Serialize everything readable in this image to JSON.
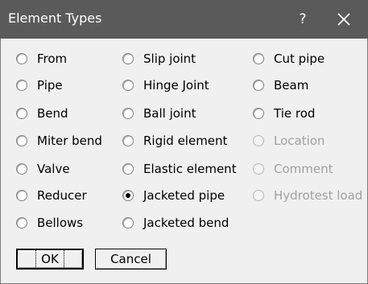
{
  "dialog": {
    "title": "Element Types",
    "help_label": "?",
    "close_icon": "close-icon"
  },
  "options": [
    {
      "label": "From",
      "checked": false,
      "enabled": true
    },
    {
      "label": "Pipe",
      "checked": false,
      "enabled": true
    },
    {
      "label": "Bend",
      "checked": false,
      "enabled": true
    },
    {
      "label": "Miter bend",
      "checked": false,
      "enabled": true
    },
    {
      "label": "Valve",
      "checked": false,
      "enabled": true
    },
    {
      "label": "Reducer",
      "checked": false,
      "enabled": true
    },
    {
      "label": "Bellows",
      "checked": false,
      "enabled": true
    },
    {
      "label": "Slip joint",
      "checked": false,
      "enabled": true
    },
    {
      "label": "Hinge Joint",
      "checked": false,
      "enabled": true
    },
    {
      "label": "Ball joint",
      "checked": false,
      "enabled": true
    },
    {
      "label": "Rigid element",
      "checked": false,
      "enabled": true
    },
    {
      "label": "Elastic element",
      "checked": false,
      "enabled": true
    },
    {
      "label": "Jacketed pipe",
      "checked": true,
      "enabled": true
    },
    {
      "label": "Jacketed bend",
      "checked": false,
      "enabled": true
    },
    {
      "label": "Cut pipe",
      "checked": false,
      "enabled": true
    },
    {
      "label": "Beam",
      "checked": false,
      "enabled": true
    },
    {
      "label": "Tie rod",
      "checked": false,
      "enabled": true
    },
    {
      "label": "Location",
      "checked": false,
      "enabled": false
    },
    {
      "label": "Comment",
      "checked": false,
      "enabled": false
    },
    {
      "label": "Hydrotest load",
      "checked": false,
      "enabled": false
    }
  ],
  "buttons": {
    "ok_label": "OK",
    "cancel_label": "Cancel"
  }
}
